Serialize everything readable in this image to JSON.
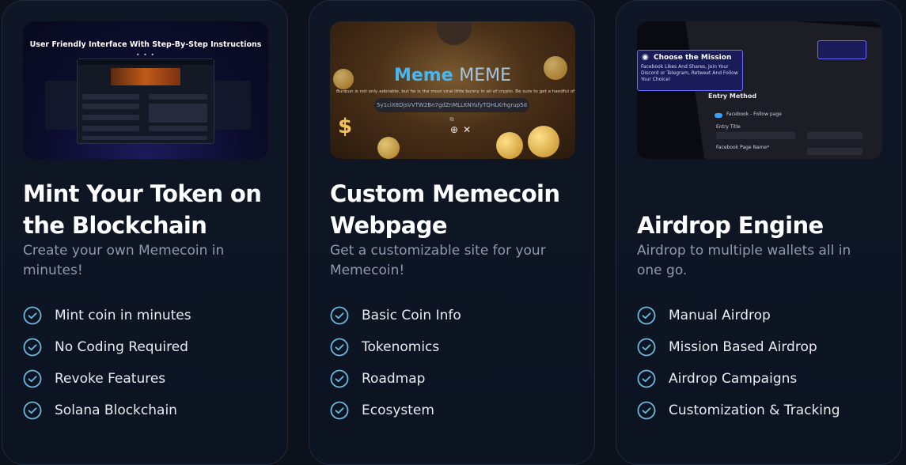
{
  "cards": [
    {
      "title_line1": "Mint Your Token on",
      "title_line2": "the Blockchain",
      "desc_line1": "Create your own Memecoin in",
      "desc_line2": "minutes!",
      "media_caption": "User Friendly Interface With Step-By-Step Instructions",
      "features": [
        "Mint coin in minutes",
        "No Coding Required",
        "Revoke Features",
        "Solana Blockchain"
      ]
    },
    {
      "title_line1": "Custom Memecoin",
      "title_line2": "Webpage",
      "desc_line1": "Get a customizable site for your",
      "desc_line2": "Memecoin!",
      "media_brand_a": "Meme",
      "media_brand_b": "MEME",
      "media_tagline": "Bunbun is not only adorable, but he is the most viral little bunny in all of crypto. Be sure to get a handful of $bbun while you can",
      "media_address": "5y1ciX8DjsVVTW2Bn7gdZnMLLKNYufyTQHLKrhgrup5d",
      "features": [
        "Basic Coin Info",
        "Tokenomics",
        "Roadmap",
        "Ecosystem"
      ]
    },
    {
      "title_line1": "Airdrop Engine",
      "desc_line1": "Airdrop to multiple wallets all in",
      "desc_line2": "one go.",
      "media_tip_title": "Choose the Mission",
      "media_tip_text": "Facebook Likes And Shares, Join Your Discord or Telegram, Retweet And Follow Your Choice!",
      "media_entry": "Entry Method",
      "media_fb": "Facebook - Follow page",
      "media_entry_title": "Entry Title",
      "media_fb_page": "Facebook Page Name*",
      "features": [
        "Manual Airdrop",
        "Mission Based Airdrop",
        "Airdrop Campaigns",
        "Customization & Tracking"
      ]
    }
  ],
  "colors": {
    "accent": "#49b6ef",
    "check": "#6cb8de",
    "card_bg": "#0f1726",
    "page_bg": "#0c111c"
  },
  "icons": {
    "feature_bullet": "check-circle-icon"
  }
}
